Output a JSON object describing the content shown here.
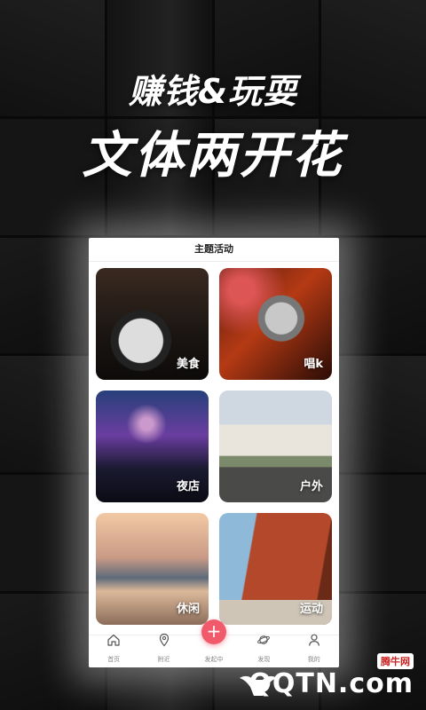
{
  "headline": {
    "line1": "赚钱&玩耍",
    "line2": "文体两开花"
  },
  "screen": {
    "title": "主题活动",
    "categories": [
      {
        "label": "美食"
      },
      {
        "label": "唱k"
      },
      {
        "label": "夜店"
      },
      {
        "label": "户外"
      },
      {
        "label": "休闲"
      },
      {
        "label": "运动"
      }
    ],
    "tabs": [
      {
        "label": "首页",
        "icon": "home-icon"
      },
      {
        "label": "附近",
        "icon": "location-pin-icon"
      },
      {
        "label": "发起中",
        "icon": "plus-icon"
      },
      {
        "label": "发现",
        "icon": "planet-icon"
      },
      {
        "label": "我的",
        "icon": "user-icon"
      }
    ],
    "add_symbol": "+"
  },
  "watermark": {
    "brand": "QQTN.com",
    "tag": "腾牛网"
  },
  "colors": {
    "accent": "#f05a6a",
    "background": "#1b1b1b"
  }
}
